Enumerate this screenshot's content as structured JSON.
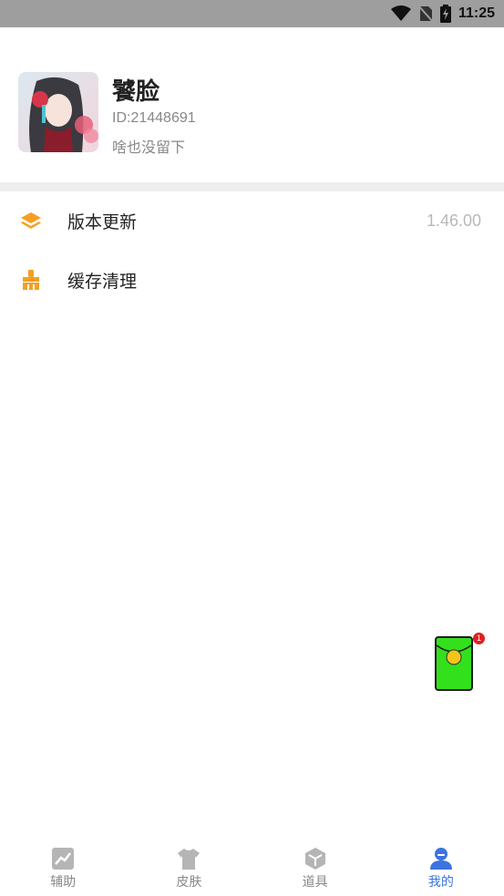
{
  "status_bar": {
    "time": "11:25",
    "icons": [
      "wifi-icon",
      "no-sim-icon",
      "battery-charging-icon"
    ]
  },
  "profile": {
    "name": "饕脸",
    "id": "ID:21448691",
    "bio": "啥也没留下"
  },
  "menu": {
    "items": [
      {
        "label": "版本更新",
        "value": "1.46.00",
        "icon": "layers-icon"
      },
      {
        "label": "缓存清理",
        "value": "",
        "icon": "broom-icon"
      }
    ]
  },
  "floating": {
    "badge_count": "1"
  },
  "tabbar": {
    "tabs": [
      {
        "label": "辅助",
        "icon": "chart-icon",
        "active": false
      },
      {
        "label": "皮肤",
        "icon": "shirt-icon",
        "active": false
      },
      {
        "label": "道具",
        "icon": "box-icon",
        "active": false
      },
      {
        "label": "我的",
        "icon": "user-icon",
        "active": true
      }
    ]
  },
  "colors": {
    "accent_orange": "#f5a023",
    "tab_active": "#3b73e0",
    "tab_inactive": "#b5b5b5"
  }
}
